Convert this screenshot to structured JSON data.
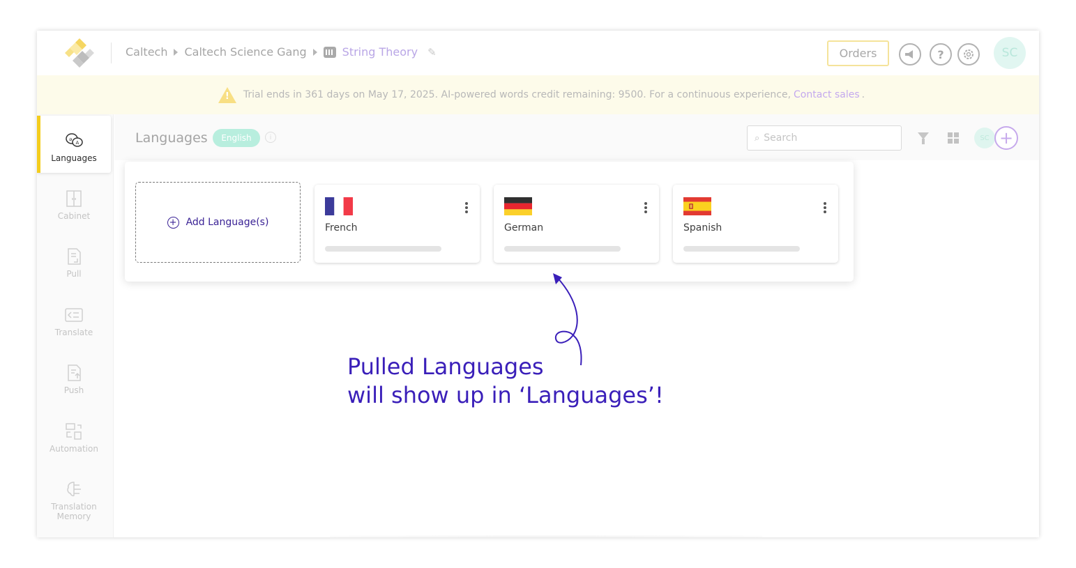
{
  "header": {
    "breadcrumb": [
      "Caltech",
      "Caltech Science Gang",
      "String Theory"
    ],
    "orders_label": "Orders",
    "avatar_initials": "SC"
  },
  "trial": {
    "message": "Trial ends in 361 days on May 17, 2025. AI-powered words credit remaining: 9500. For a continuous experience,",
    "link": "Contact sales",
    "suffix": "."
  },
  "sidebar": {
    "items": [
      {
        "label": "Languages",
        "icon": "languages-icon",
        "active": true
      },
      {
        "label": "Cabinet",
        "icon": "cabinet-icon",
        "active": false
      },
      {
        "label": "Pull",
        "icon": "pull-icon",
        "active": false
      },
      {
        "label": "Translate",
        "icon": "translate-icon",
        "active": false
      },
      {
        "label": "Push",
        "icon": "push-icon",
        "active": false
      },
      {
        "label": "Automation",
        "icon": "automation-icon",
        "active": false
      },
      {
        "label": "Translation Memory",
        "icon": "translation-memory-icon",
        "active": false
      }
    ]
  },
  "main": {
    "title": "Languages",
    "badge": "English",
    "search_placeholder": "Search",
    "mini_avatar": "SC",
    "add_language_label": "Add Language(s)",
    "languages": [
      {
        "name": "French",
        "flag": "fr",
        "progress": 0
      },
      {
        "name": "German",
        "flag": "de",
        "progress": 0
      },
      {
        "name": "Spanish",
        "flag": "es",
        "progress": 0
      }
    ]
  },
  "annotation": {
    "line1": "Pulled Languages",
    "line2": "will show up in ‘Languages’!"
  },
  "colors": {
    "accent": "#3a1fb9",
    "sidebar_active_bar": "#f4cd1d",
    "trial_bg": "#fdfbea",
    "link": "#c4a9ee"
  }
}
